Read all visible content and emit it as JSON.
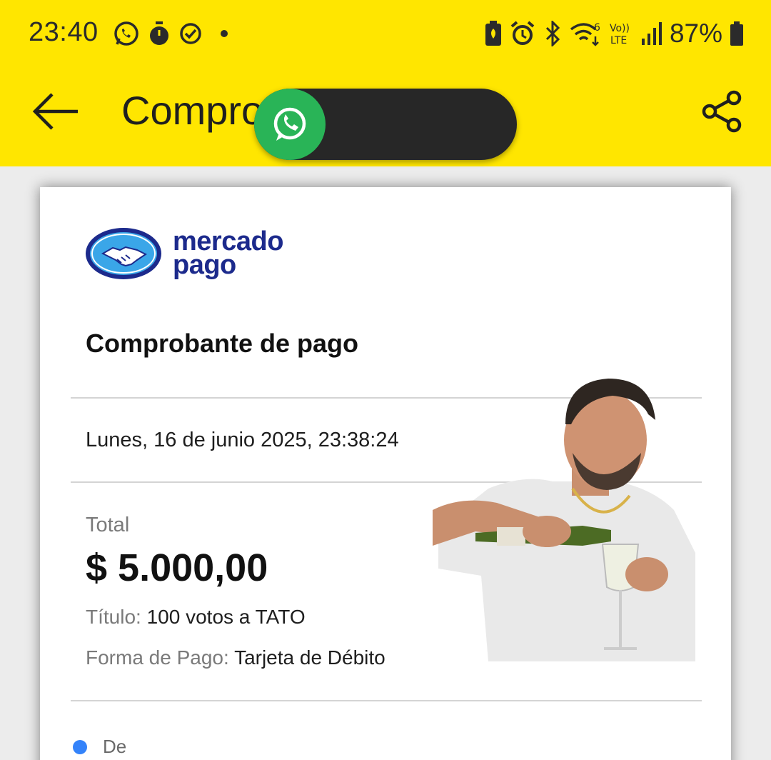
{
  "status_bar": {
    "time": "23:40",
    "left_icons": [
      "whatsapp-icon",
      "stopwatch-icon",
      "task-check-icon",
      "dot-icon"
    ],
    "right_icons": [
      "battery-saver-icon",
      "alarm-icon",
      "bluetooth-icon",
      "wifi-6-icon",
      "volte-icon",
      "signal-icon"
    ],
    "battery_percent": "87%"
  },
  "toolbar": {
    "title": "Compro",
    "back_icon": "arrow-left-icon",
    "share_icon": "share-icon"
  },
  "overlay": {
    "app": "whatsapp-icon"
  },
  "receipt": {
    "logo_line1": "mercado",
    "logo_line2": "pago",
    "title": "Comprobante de pago",
    "date": "Lunes, 16 de junio 2025, 23:38:24",
    "total_label": "Total",
    "total_amount": "$ 5.000,00",
    "title_label": "Título:",
    "title_value": "100 votos a TATO",
    "payment_label": "Forma de Pago:",
    "payment_value": "Tarjeta de Débito",
    "from_label": "De"
  },
  "colors": {
    "header_yellow": "#ffe600",
    "brand_blue": "#1c2a8c",
    "whatsapp_green": "#29b457",
    "accent_blue": "#3483fa"
  }
}
